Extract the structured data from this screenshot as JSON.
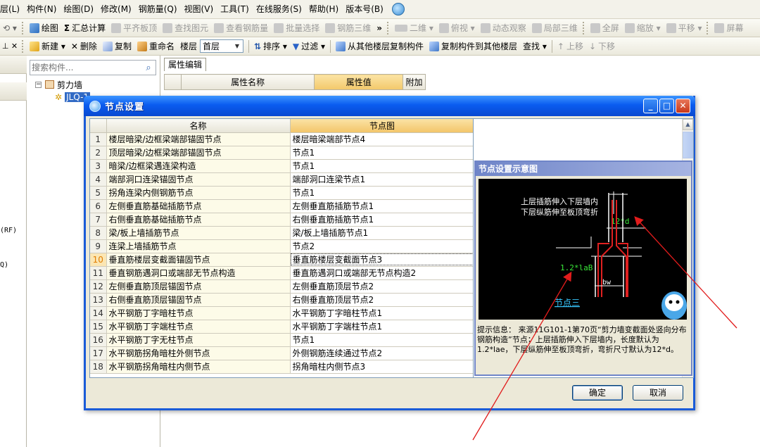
{
  "menu": {
    "items": [
      "层(L)",
      "构件(N)",
      "绘图(D)",
      "修改(M)",
      "钢筋量(Q)",
      "视图(V)",
      "工具(T)",
      "在线服务(S)",
      "帮助(H)",
      "版本号(B)"
    ]
  },
  "toolbar1": {
    "draw": "绘图",
    "sum_calc": "汇总计算",
    "level_slab": "平齐板顶",
    "find_element": "查找图元",
    "view_rebar": "查看钢筋量",
    "batch_select": "批量选择",
    "rebar_3d": "钢筋三维",
    "view_2d": "二维",
    "view_top": "俯视",
    "dynamic_view": "动态观察",
    "local_3d": "局部三维",
    "fullscreen": "全屏",
    "zoom": "缩放",
    "pan": "平移",
    "screen": "屏幕"
  },
  "toolbar2": {
    "new": "新建",
    "delete": "删除",
    "copy": "复制",
    "rename": "重命名",
    "floor_label": "楼层",
    "floor_value": "首层",
    "sort": "排序",
    "filter": "过滤",
    "copy_from_floor": "从其他楼层复制构件",
    "copy_to_floor": "复制构件到其他楼层",
    "find": "查找",
    "move_up": "上移",
    "move_down": "下移"
  },
  "left_panel": {
    "search_placeholder": "搜索构件...",
    "tree_root": "剪力墙",
    "tree_child": "JLQ-1"
  },
  "left_strip": {
    "text_rf": "(RF)",
    "text_q": "Q)"
  },
  "property": {
    "tab": "属性编辑",
    "col_name": "属性名称",
    "col_value": "属性值",
    "col_extra": "附加"
  },
  "dialog": {
    "title": "节点设置",
    "col_name": "名称",
    "col_node": "节点图",
    "selected_row": 10,
    "rows": [
      {
        "num": "1",
        "name": "楼层暗梁/边框梁端部锚固节点",
        "node": "楼层暗梁端部节点4"
      },
      {
        "num": "2",
        "name": "顶层暗梁/边框梁端部锚固节点",
        "node": "节点1"
      },
      {
        "num": "3",
        "name": "暗梁/边框梁遇连梁构造",
        "node": "节点1"
      },
      {
        "num": "4",
        "name": "端部洞口连梁锚固节点",
        "node": "端部洞口连梁节点1"
      },
      {
        "num": "5",
        "name": "拐角连梁内侧钢筋节点",
        "node": "节点1"
      },
      {
        "num": "6",
        "name": "左侧垂直筋基础插筋节点",
        "node": "左侧垂直筋插筋节点1"
      },
      {
        "num": "7",
        "name": "右侧垂直筋基础插筋节点",
        "node": "右侧垂直筋插筋节点1"
      },
      {
        "num": "8",
        "name": "梁/板上墙插筋节点",
        "node": "梁/板上墙插筋节点1"
      },
      {
        "num": "9",
        "name": "连梁上墙插筋节点",
        "node": "节点2"
      },
      {
        "num": "10",
        "name": "垂直筋楼层变截面锚固节点",
        "node": "垂直筋楼层变截面节点3"
      },
      {
        "num": "11",
        "name": "垂直钢筋遇洞口或端部无节点构造",
        "node": "垂直筋遇洞口或端部无节点构造2"
      },
      {
        "num": "12",
        "name": "左侧垂直筋顶层锚固节点",
        "node": "左侧垂直筋顶层节点2"
      },
      {
        "num": "13",
        "name": "右侧垂直筋顶层锚固节点",
        "node": "右侧垂直筋顶层节点2"
      },
      {
        "num": "14",
        "name": "水平钢筋丁字暗柱节点",
        "node": "水平钢筋丁字暗柱节点1"
      },
      {
        "num": "15",
        "name": "水平钢筋丁字端柱节点",
        "node": "水平钢筋丁字端柱节点1"
      },
      {
        "num": "16",
        "name": "水平钢筋丁字无柱节点",
        "node": "节点1"
      },
      {
        "num": "17",
        "name": "水平钢筋拐角暗柱外侧节点",
        "node": "外侧钢筋连续通过节点2"
      },
      {
        "num": "18",
        "name": "水平钢筋拐角暗柱内侧节点",
        "node": "拐角暗柱内侧节点3"
      }
    ],
    "preview": {
      "title": "节点设置示意图",
      "diagram_text_1": "上层插筋伸入下层墙内",
      "diagram_text_2": "下层纵筋伸至板顶弯折",
      "label_12d": "12*d",
      "label_lab": "1.2*laB",
      "label_bw": "bw",
      "node_name": "节点三",
      "hint": "提示信息： 来源11G101-1第70页“剪力墙变截面处竖向分布钢筋构造”节点；上层插筋伸入下层墙内，长度默认为1.2*lae，下层纵筋伸至板顶弯折，弯折尺寸默认为12*d。"
    },
    "ok": "确定",
    "cancel": "取消"
  },
  "colors": {
    "title_blue": "#0a5cf0",
    "header_orange": "#f3c66a",
    "annotation_red": "#e11c1c",
    "diagram_green": "#39e639",
    "rebar_red": "#e02020"
  }
}
